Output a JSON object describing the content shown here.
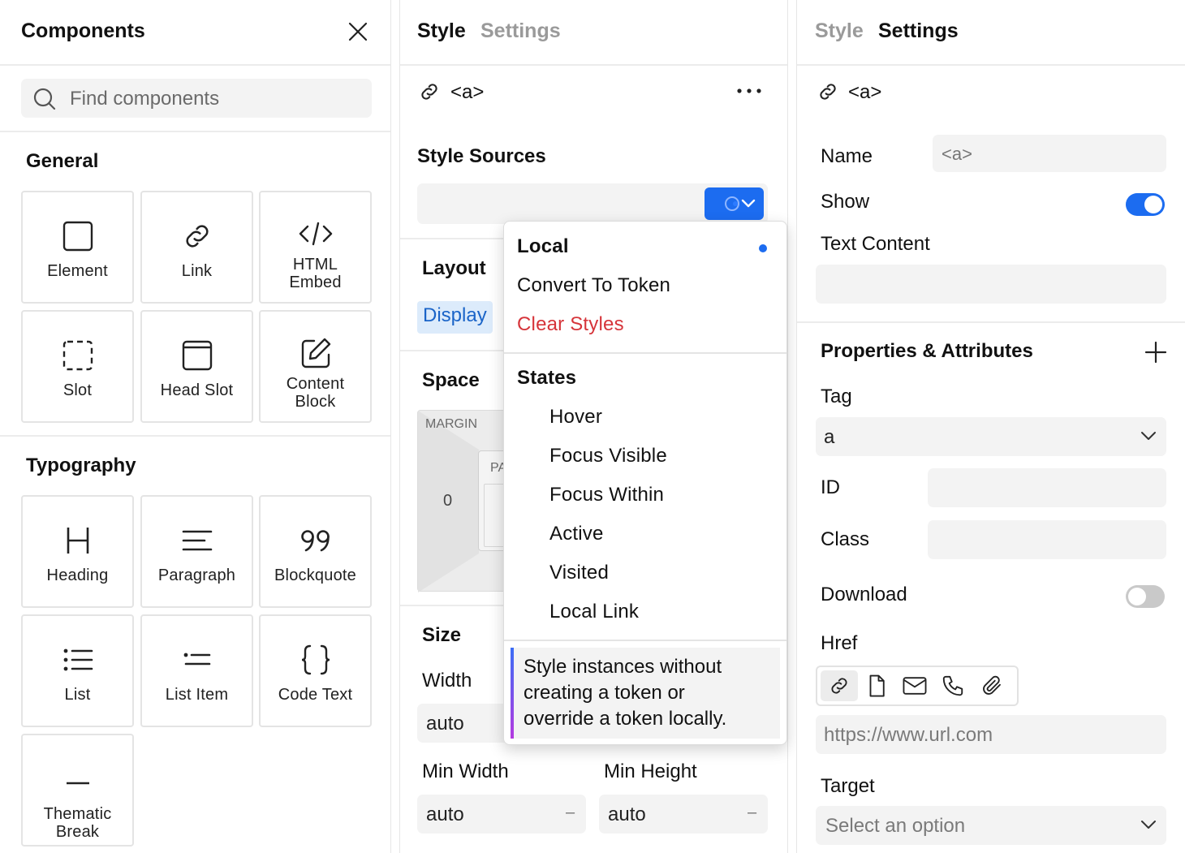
{
  "components_panel": {
    "title": "Components",
    "search_placeholder": "Find components",
    "general_title": "General",
    "general_items": [
      "Element",
      "Link",
      "HTML Embed",
      "Slot",
      "Head Slot",
      "Content Block"
    ],
    "typography_title": "Typography",
    "typography_items": [
      "Heading",
      "Paragraph",
      "Blockquote",
      "List",
      "List Item",
      "Code Text",
      "Thematic Break"
    ]
  },
  "style_panel": {
    "tab_style": "Style",
    "tab_settings": "Settings",
    "active_tab": "Style",
    "element_tag": "<a>",
    "style_sources_title": "Style Sources",
    "layout_title": "Layout",
    "display_label": "Display",
    "space_title": "Space",
    "margin_label": "MARGIN",
    "margin_value": "0",
    "padding_label_partial": "PA",
    "size_title": "Size",
    "width_label": "Width",
    "width_value": "auto",
    "min_width_label": "Min Width",
    "min_width_value": "auto",
    "min_height_label": "Min Height",
    "min_height_value": "auto",
    "dash": "–"
  },
  "dropdown_menu": {
    "local": "Local",
    "convert_to_token": "Convert To Token",
    "clear_styles": "Clear Styles",
    "states_title": "States",
    "states": [
      "Hover",
      "Focus Visible",
      "Focus Within",
      "Active",
      "Visited",
      "Local Link"
    ],
    "hint_lines": [
      "Style instances without",
      "creating a token or",
      "override a token locally."
    ],
    "accent_color": "#1c6cf0",
    "danger_color": "#d6343a"
  },
  "settings_panel": {
    "tab_style": "Style",
    "tab_settings": "Settings",
    "active_tab": "Settings",
    "element_tag": "<a>",
    "name_label": "Name",
    "name_placeholder": "<a>",
    "show_label": "Show",
    "show_on": true,
    "text_content_label": "Text Content",
    "props_title": "Properties & Attributes",
    "tag_label": "Tag",
    "tag_value": "a",
    "id_label": "ID",
    "class_label": "Class",
    "download_label": "Download",
    "download_on": false,
    "href_label": "Href",
    "href_placeholder": "https://www.url.com",
    "target_label": "Target",
    "target_placeholder": "Select an option"
  }
}
